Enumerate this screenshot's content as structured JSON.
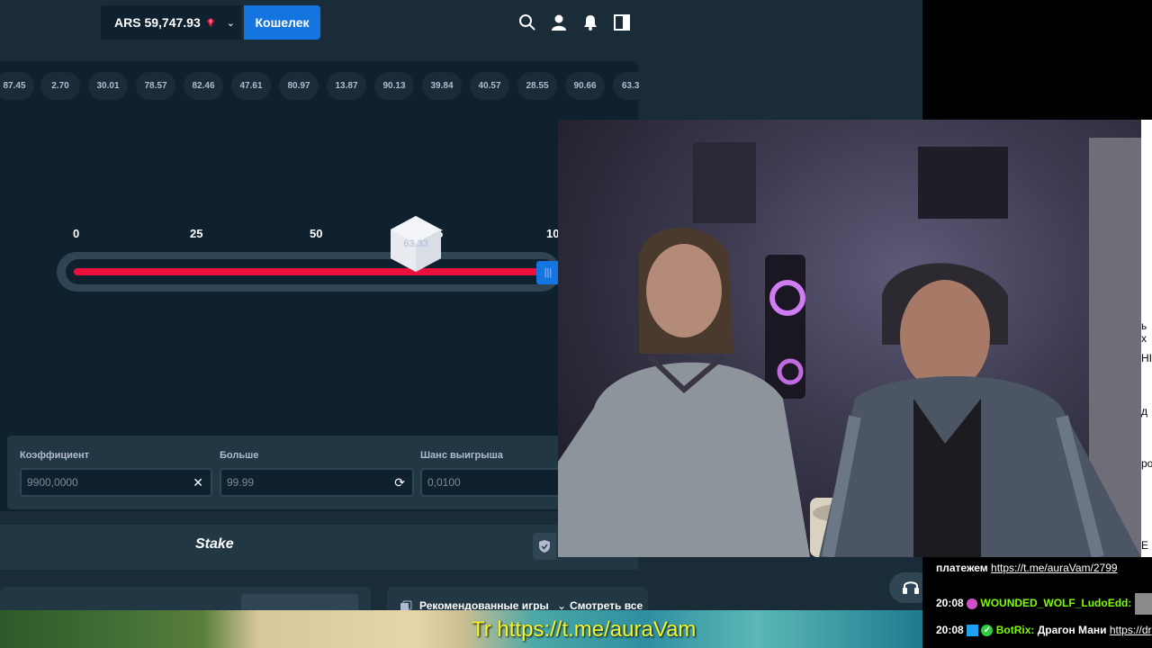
{
  "header": {
    "balance": "ARS 59,747.93",
    "wallet_label": "Кошелек"
  },
  "history": [
    "87.45",
    "2.70",
    "30.01",
    "78.57",
    "82.46",
    "47.61",
    "80.97",
    "13.87",
    "90.13",
    "39.84",
    "40.57",
    "28.55",
    "90.66",
    "63.3"
  ],
  "slider": {
    "scale": [
      "0",
      "25",
      "50",
      "5",
      "10"
    ],
    "result": "63.33",
    "handle_glyph": "|||"
  },
  "bet": {
    "multiplier_label": "Коэффициент",
    "multiplier_value": "9900,0000",
    "over_label": "Больше",
    "over_value": "99.99",
    "chance_label": "Шанс выигрыша",
    "chance_value": "0,0100"
  },
  "footer": {
    "logo": "Stake",
    "recommended": "Рекомендованные игры",
    "see_all": "Смотреть все"
  },
  "chat": {
    "line1_text": "платежем",
    "line1_link": "https://t.me/auraVam/2799",
    "line2_time": "20:08",
    "line2_user": "WOUNDED_WOLF_LudoEdd:",
    "line3_time": "20:08",
    "line3_user": "BotRix:",
    "line3_text": "Драгон Мани",
    "line3_link": "https://dr",
    "side_fragments": [
      "ь х",
      "НІ",
      "д",
      "ро",
      "Е"
    ]
  },
  "overlay": {
    "promo": "Tr https://t.me/auraVam"
  },
  "colors": {
    "bg": "#1a2c38",
    "panel": "#0f212e",
    "accent_blue": "#1475e1",
    "red": "#e9113c",
    "promo_yellow": "#f5f52a",
    "chat_name_green": "#7cfc00"
  }
}
